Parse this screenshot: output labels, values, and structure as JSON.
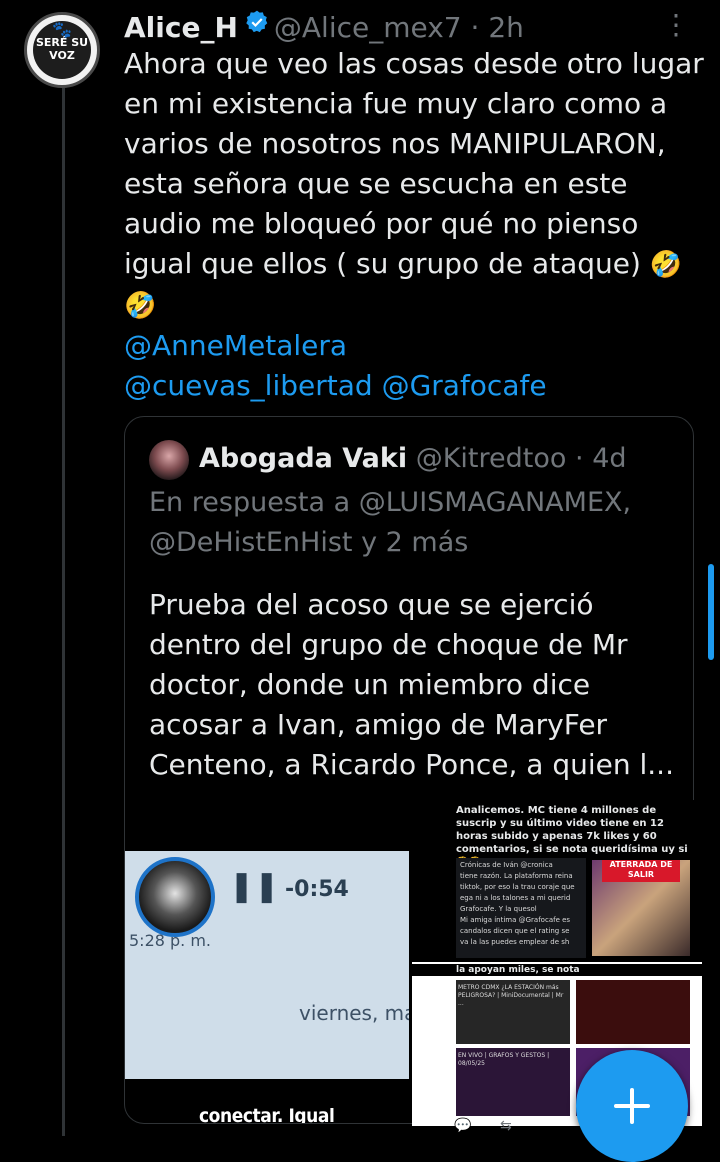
{
  "tweet": {
    "avatar_lines": [
      "SERÉ SU",
      "VOZ"
    ],
    "name": "Alice_H",
    "handle": "@Alice_mex7",
    "separator": "·",
    "time": "2h",
    "more": "⋮",
    "text_lines": [
      "Ahora que veo las cosas desde otro lugar",
      "en mi existencia  fue muy claro como a",
      "varios de nosotros nos MANIPULARON,",
      "esta señora que se escucha en este",
      "audio me bloqueó por qué no pienso",
      "igual que ellos ( su grupo de ataque)"
    ],
    "emoji": "🤣",
    "mentions": [
      "@AnneMetalera",
      "@cuevas_libertad",
      "@Grafocafe"
    ]
  },
  "quote": {
    "name": "Abogada Vaki",
    "handle": "@Kitredtoo",
    "separator": "·",
    "time": "4d",
    "reply_prefix": "En respuesta a",
    "reply_to_1": "@LUISMAGANAMEX,",
    "reply_to_2": "@DeHistEnHist",
    "reply_suffix": "y 2 más",
    "text_lines": [
      "Prueba del acoso que se ejerció",
      "dentro del grupo de choque de Mr",
      "doctor, donde un miembro dice",
      "acosar a Ivan, amigo de MaryFer",
      "Centeno, a Ricardo Ponce, a quien l..."
    ],
    "media": {
      "duration": "-0:54",
      "timestamp": "5:28 p. m.",
      "day": "viernes, ma",
      "caption": "conectar. Igual"
    },
    "screenshot": {
      "headline": "Analicemos. MC tiene 4 millones de suscrip y su último video tiene en 12 horas subido y apenas 7k likes y 60 comentarios, si se nota queridísima uy si 🤔🤔",
      "card_lines": [
        "Crónicas de Iván @cronica",
        "tiene razón. La plataforma reina",
        "tiktok, por eso la trau coraje que",
        "ega ni a los talones a mi querid",
        "Grafocafe. Y la quesol",
        "Mi amiga íntima @Grafocafe es",
        "candalos dicen que el rating se",
        "va la las puedes emplear de sh"
      ],
      "tag": "ATERRADA DE SALIR",
      "mid": "la apoyan miles, se nota",
      "grid_texts": [
        "METRO CDMX ¿LA ESTACIÓN más PELIGROSA? | MiniDocumental | Mr ...",
        "EN VIVO | GRAFOS Y GESTOS | 08/05/25"
      ]
    }
  },
  "colors": {
    "accent": "#1d9bf0",
    "background": "#000000",
    "text": "#e7e9ea",
    "secondary": "#71767b",
    "border": "#2f3336"
  },
  "icons": {
    "verified": "verified-badge-icon",
    "more": "more-options-icon",
    "compose": "compose-plus-icon"
  }
}
